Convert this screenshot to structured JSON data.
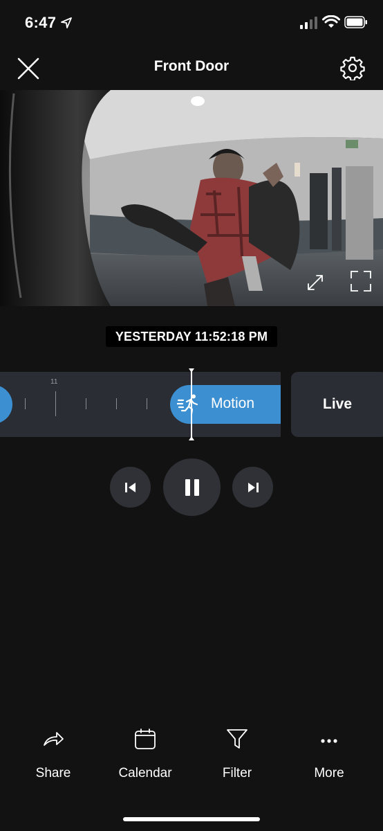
{
  "status_bar": {
    "time": "6:47"
  },
  "header": {
    "title": "Front Door"
  },
  "video": {
    "timestamp": "YESTERDAY 11:52:18 PM"
  },
  "timeline": {
    "tick_label": "11",
    "event_label": "Motion",
    "live_label": "Live"
  },
  "toolbar": {
    "share": "Share",
    "calendar": "Calendar",
    "filter": "Filter",
    "more": "More"
  },
  "colors": {
    "accent": "#3c8fd1",
    "background": "#121212",
    "panel": "#2a2d33"
  },
  "icons": {
    "close": "close-icon",
    "settings": "gear-icon",
    "expand": "expand-icon",
    "fullscreen": "fullscreen-icon",
    "motion": "running-person-icon",
    "prev": "skip-previous-icon",
    "pause": "pause-icon",
    "next": "skip-next-icon",
    "share": "share-arrow-icon",
    "calendar": "calendar-icon",
    "filter": "funnel-icon",
    "more": "ellipsis-icon"
  }
}
